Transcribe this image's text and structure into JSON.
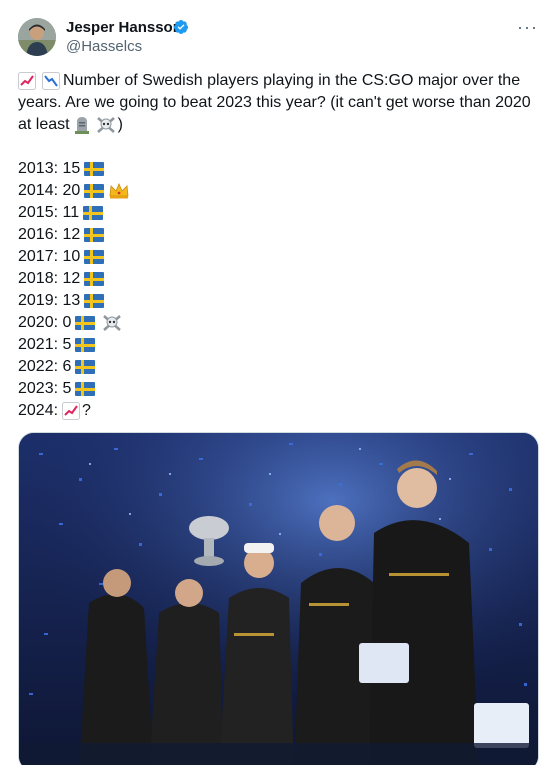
{
  "author": {
    "name": "Jesper Hansson",
    "handle": "@Hasselcs",
    "verified": true,
    "avatar_icon": "avatar-photo"
  },
  "menu": {
    "more_label": "···"
  },
  "tweet": {
    "line1": "Number of Swedish players playing in the CS:GO major over the",
    "line2": "years. Are we going to beat 2023 this year? (it can't get worse than 2020",
    "line3": "at least",
    "line3_end": ")",
    "leading_icons": [
      "chart-increasing-icon",
      "chart-decreasing-icon"
    ],
    "trailing_icons": [
      "headstone-icon",
      "skull-crossbones-icon"
    ],
    "years": [
      {
        "text": "2013: 15",
        "flag": true,
        "extra": ""
      },
      {
        "text": "2014: 20",
        "flag": true,
        "extra": "crown-icon"
      },
      {
        "text": "2015: 11",
        "flag": true,
        "extra": ""
      },
      {
        "text": "2016: 12",
        "flag": true,
        "extra": ""
      },
      {
        "text": "2017: 10",
        "flag": true,
        "extra": ""
      },
      {
        "text": "2018: 12",
        "flag": true,
        "extra": ""
      },
      {
        "text": "2019: 13",
        "flag": true,
        "extra": ""
      },
      {
        "text": "2020: 0",
        "flag": true,
        "extra": "skull-crossbones-icon"
      },
      {
        "text": "2021: 5",
        "flag": true,
        "extra": ""
      },
      {
        "text": "2022: 6",
        "flag": true,
        "extra": ""
      },
      {
        "text": "2023: 5",
        "flag": true,
        "extra": ""
      },
      {
        "text": "2024:",
        "flag": false,
        "extra": "chart-increasing-icon",
        "suffix": "?"
      }
    ]
  },
  "media": {
    "type": "photo",
    "colors": {
      "background": "#1a2a55",
      "confetti": "#2f5fd0",
      "jersey": "#1b1b1b",
      "trophy": "#c9ccd2"
    }
  },
  "colors": {
    "text": "#0f1419",
    "secondary": "#536471",
    "verified": "#1d9bf0",
    "flag_blue": "#2e6fb8",
    "flag_yellow": "#f3c51c"
  }
}
